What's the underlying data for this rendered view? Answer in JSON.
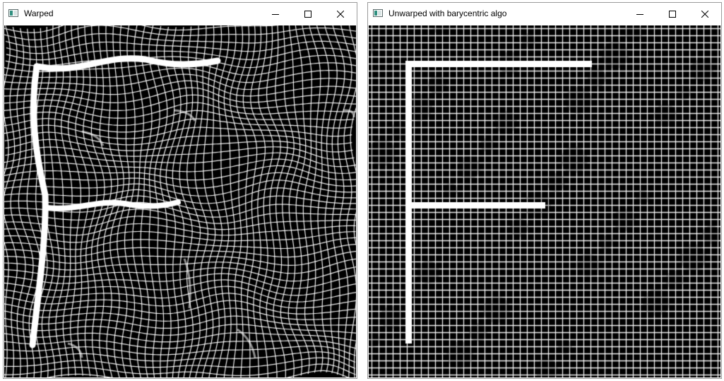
{
  "windows": [
    {
      "title": "Warped",
      "icon": "opencv-window-icon",
      "controls": [
        "minimize",
        "maximize",
        "close"
      ],
      "content": {
        "description_icon": "warped-grid-image",
        "grid_color": "#ffffff",
        "background_color": "#000000"
      }
    },
    {
      "title": "Unwarped with barycentric algo",
      "icon": "opencv-window-icon",
      "controls": [
        "minimize",
        "maximize",
        "close"
      ],
      "content": {
        "description_icon": "unwarped-grid-image",
        "grid_color": "#ffffff",
        "background_color": "#000000"
      }
    }
  ]
}
